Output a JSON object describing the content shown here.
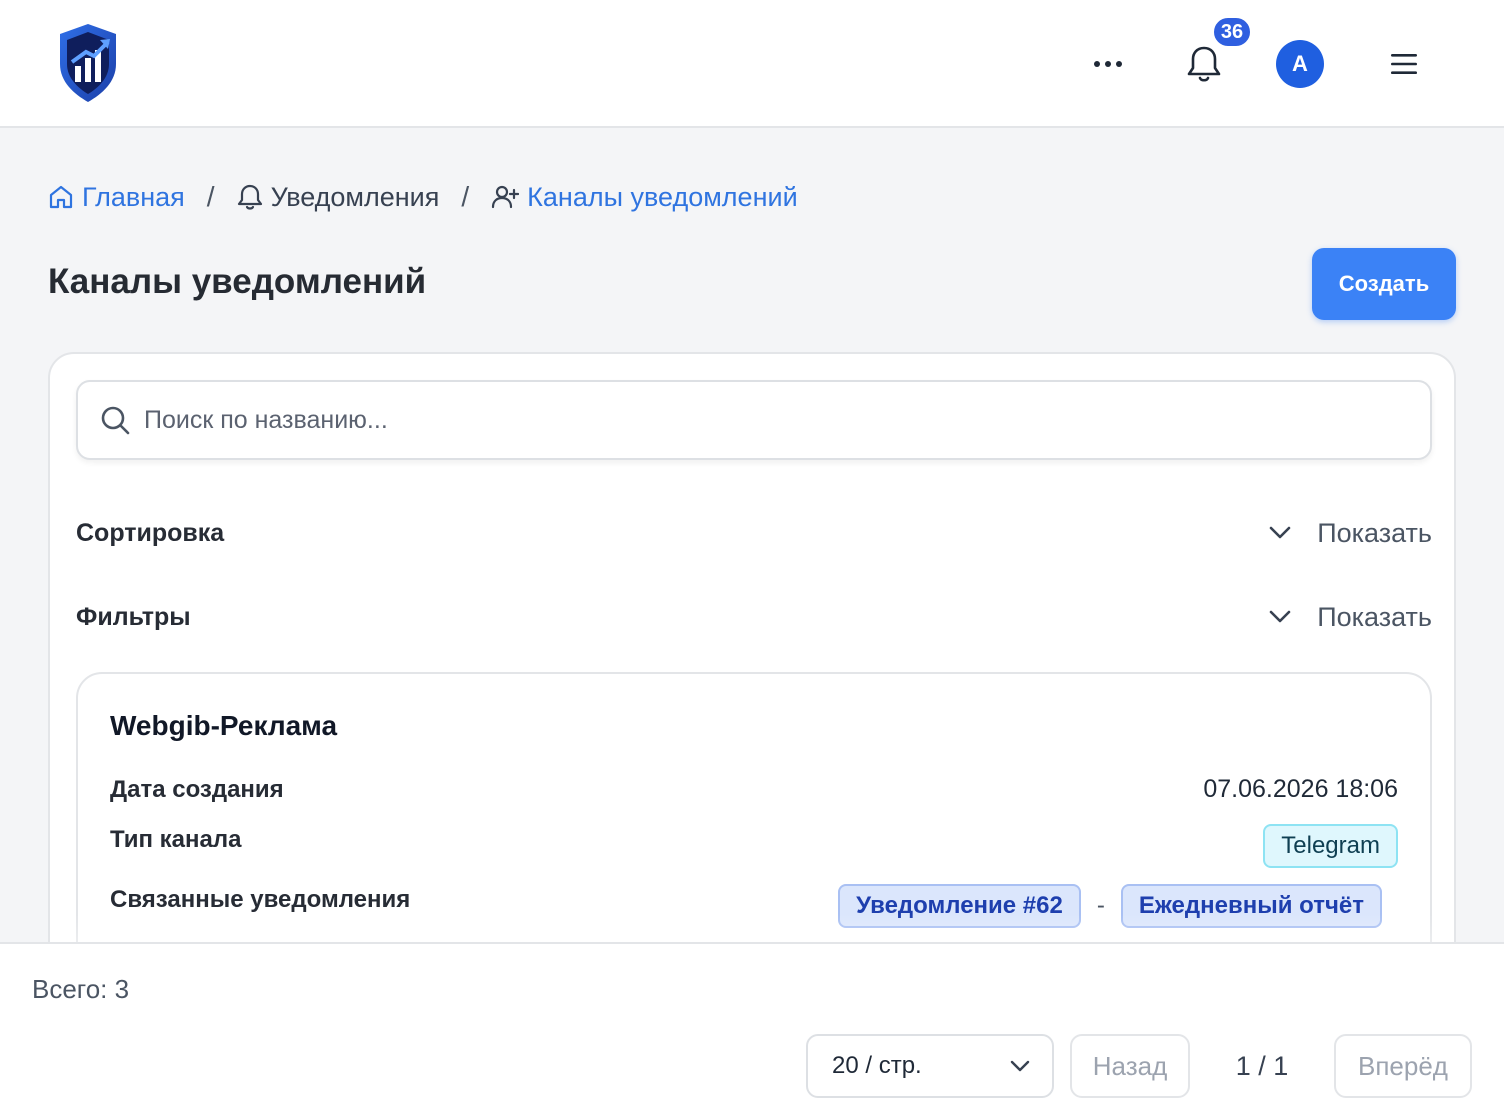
{
  "header": {
    "notifications_count": "36",
    "avatar_initial": "A"
  },
  "breadcrumb": {
    "home": "Главная",
    "notifications": "Уведомления",
    "current": "Каналы уведомлений"
  },
  "page": {
    "title": "Каналы уведомлений",
    "create_label": "Создать"
  },
  "search": {
    "placeholder": "Поиск по названию..."
  },
  "sections": {
    "sort_title": "Сортировка",
    "sort_toggle": "Показать",
    "filter_title": "Фильтры",
    "filter_toggle": "Показать"
  },
  "channels": [
    {
      "name": "Webgib-Реклама",
      "created_label": "Дата создания",
      "created_value": "07.06.2026 18:06",
      "type_label": "Тип канала",
      "type_value": "Telegram",
      "linked_label": "Связанные уведомления",
      "linked_notification": "Уведомление #62",
      "linked_separator": "-",
      "linked_name": "Ежедневный отчёт"
    }
  ],
  "footer": {
    "total": "Всего: 3",
    "page_size": "20 / стр.",
    "prev": "Назад",
    "page_indicator": "1 / 1",
    "next": "Вперёд"
  },
  "colors": {
    "primary": "#3b82f6",
    "link": "#2f74e0",
    "badge": "#2f5fe0",
    "background": "#f4f5f7"
  }
}
